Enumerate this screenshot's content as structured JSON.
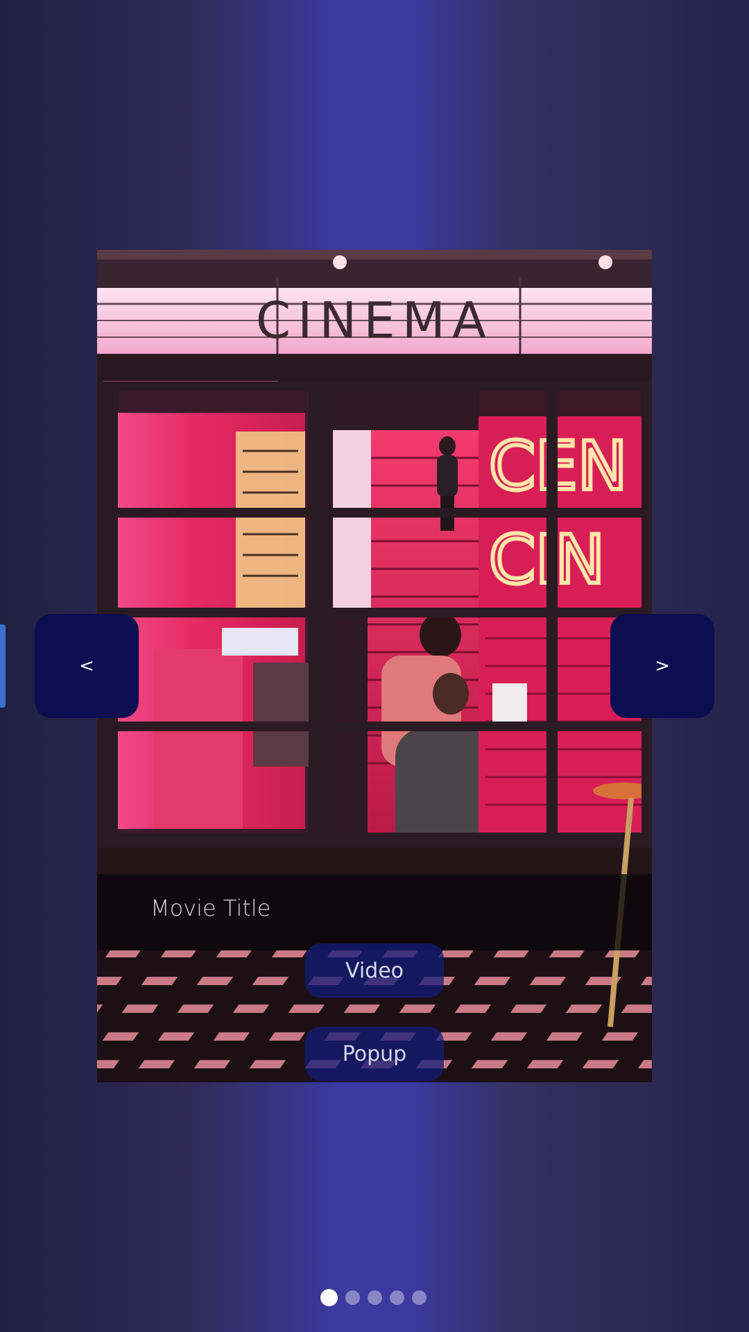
{
  "carousel": {
    "prev_label": "<",
    "next_label": ">",
    "active_index": 0,
    "dot_count": 5
  },
  "card": {
    "image_icon": "cinema-storefront-image",
    "image_sign_text": "CINEMA",
    "image_neon_text": [
      "CEN",
      "CIN"
    ],
    "title": "Movie Title",
    "video_label": "Video",
    "popup_label": "Popup"
  },
  "colors": {
    "nav_button": "#0b0f52",
    "pill_button": "#121c78",
    "active_dot": "#ffffff",
    "background_accent": "#3a3aa0"
  }
}
